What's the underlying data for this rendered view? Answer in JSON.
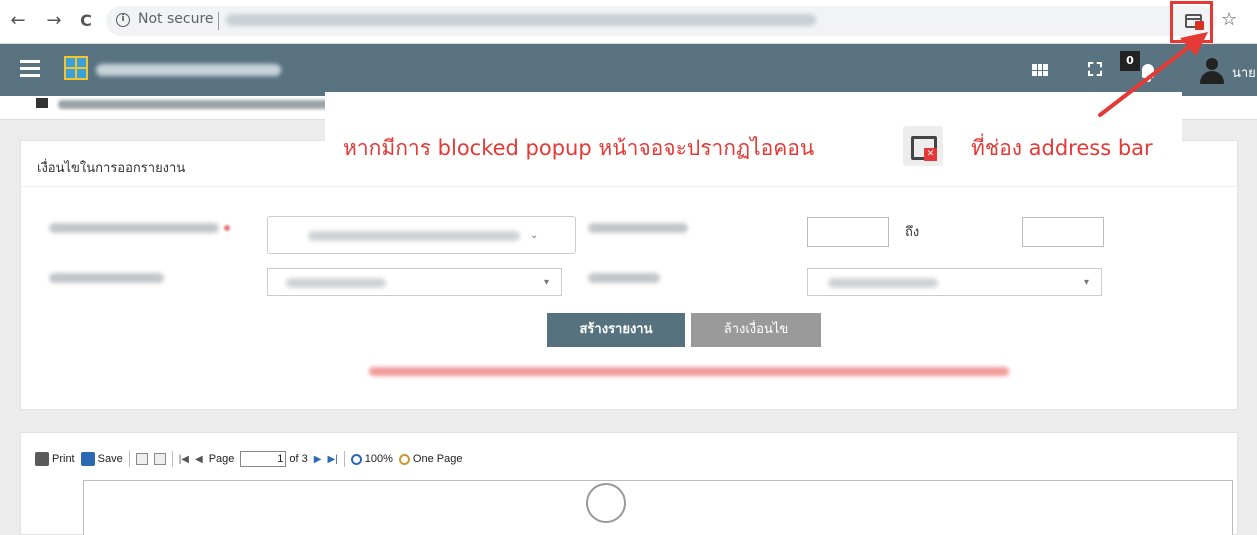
{
  "browser": {
    "back": "←",
    "forward": "→",
    "reload": "C",
    "security_label": "Not secure",
    "bookmark_star": "☆"
  },
  "appbar": {
    "notification_count": "0",
    "user_name": "นาย"
  },
  "conditions": {
    "title": "เงื่อนไขในการออกรายงาน",
    "to_label": "ถึง",
    "create_button": "สร้างรายงาน",
    "clear_button": "ล้างเงื่อนไข"
  },
  "annotation": {
    "text_before_icon": "หากมีการ blocked popup หน้าจอจะปรากฏไอคอน",
    "text_after_icon": "ที่ช่อง address bar",
    "accent_color": "#e53935"
  },
  "report_toolbar": {
    "print": "Print",
    "save": "Save",
    "page_label": "Page",
    "page_value": "1",
    "page_total": "of 3",
    "zoom": "100%",
    "one_page": "One Page"
  },
  "icons": [
    "popup-blocked-icon",
    "star-icon",
    "hamburger-icon",
    "grid-icon",
    "fullscreen-icon",
    "bell-icon",
    "user-icon",
    "home-icon",
    "print-icon",
    "save-icon",
    "zoom-icon"
  ]
}
